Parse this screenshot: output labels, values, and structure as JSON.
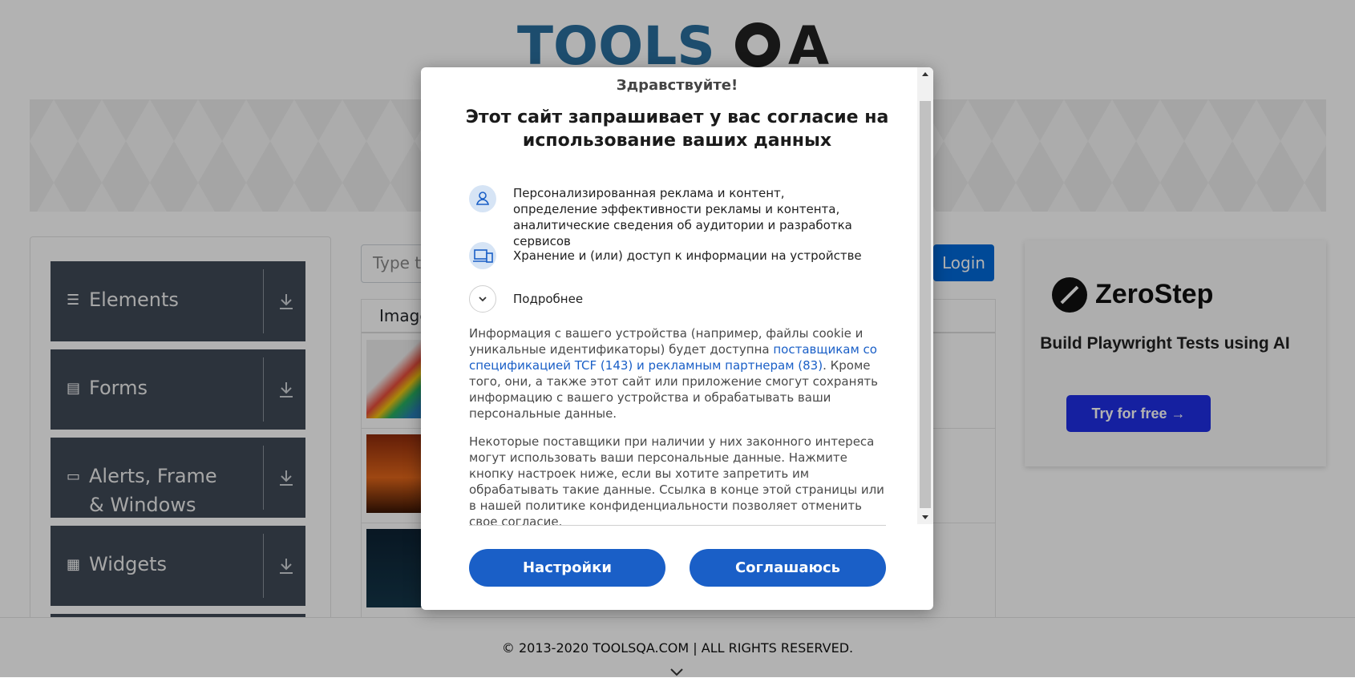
{
  "background": {
    "logo_text": "TOOLSQA",
    "sidebar": {
      "groups": [
        {
          "label": "Elements",
          "icon": "menu-icon"
        },
        {
          "label": "Forms",
          "icon": "document-icon"
        },
        {
          "label": "Alerts, Frame & Windows",
          "icon": "window-icon"
        },
        {
          "label": "Widgets",
          "icon": "grid-icon"
        }
      ]
    },
    "search_placeholder": "Type to search",
    "login_label": "Login",
    "table_header": "Image",
    "ad": {
      "brand": "ZeroStep",
      "tagline": "Build Playwright Tests using AI",
      "cta": "Try for free →",
      "accent": "#1f2ee6"
    },
    "footer_text": "© 2013-2020 TOOLSQA.COM | ALL RIGHTS RESERVED."
  },
  "consent": {
    "greeting": "Здравствуйте!",
    "title": "Этот сайт запрашивает у вас согласие на использование ваших данных",
    "purposes": [
      {
        "icon": "person-icon",
        "text": "Персонализированная реклама и контент, определение эффективности рекламы и контента, аналитические сведения об аудитории и разработка сервисов"
      },
      {
        "icon": "devices-icon",
        "text": "Хранение и (или) доступ к информации на устройстве"
      }
    ],
    "more_label": "Подробнее",
    "paragraph1_pre": "Информация с вашего устройства (например, файлы cookie и уникальные идентификаторы) будет доступна ",
    "paragraph1_link": "поставщикам со спецификацией TCF (143) и рекламным партнерам (83)",
    "paragraph1_post": ". Кроме того, они, а также этот сайт или приложение смогут сохранять информацию с вашего устройства и обрабатывать ваши персональные данные.",
    "paragraph2": "Некоторые поставщики при наличии у них законного интереса могут использовать ваши персональные данные. Нажмите кнопку настроек ниже, если вы хотите запретить им обрабатывать такие данные. Ссылка в конце этой страницы или в нашей политике конфиденциальности позволяет отменить свое согласие.",
    "settings_label": "Настройки",
    "accept_label": "Соглашаюсь",
    "accent": "#1a5fc7"
  }
}
